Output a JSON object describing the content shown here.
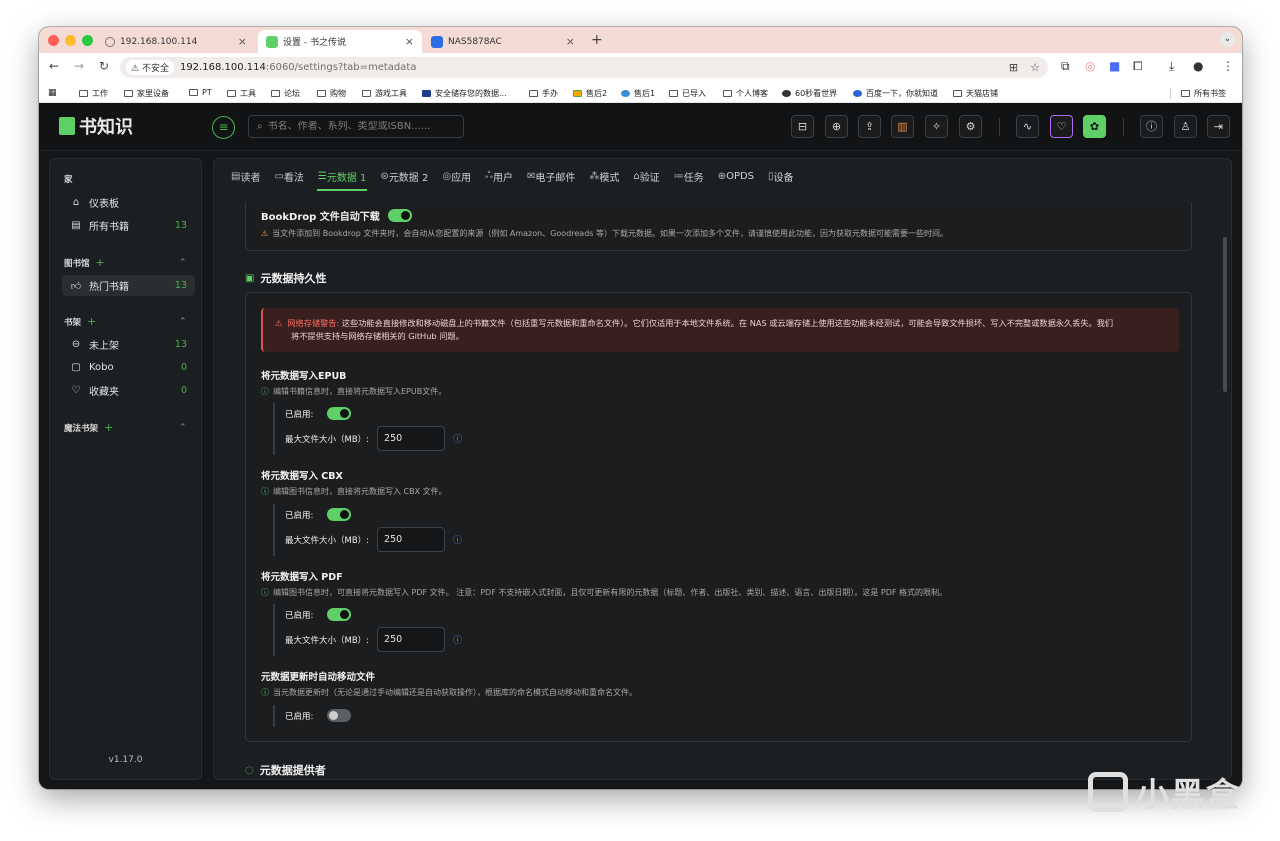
{
  "browser": {
    "tabs": [
      {
        "title": "192.168.100.114"
      },
      {
        "title": "设置 - 书之传说"
      },
      {
        "title": "NAS5878AC"
      }
    ],
    "security_label": "不安全",
    "url_host": "192.168.100.114",
    "url_path": ":6060/settings?tab=metadata",
    "bookmarks": [
      "工作",
      "家里设备",
      "PT",
      "工具",
      "论坛",
      "购物",
      "游戏工具",
      "安全储存您的数据...",
      "手办",
      "售后2",
      "售后1",
      "已导入",
      "个人博客",
      "60秒看世界",
      "百度一下，你就知道",
      "天猫店铺"
    ],
    "all_bookmarks": "所有书签"
  },
  "app": {
    "logo": "书知识",
    "search_placeholder": "书名、作者、系列、类型或ISBN......"
  },
  "sidebar": {
    "home_section": "家",
    "home_items": [
      {
        "label": "仪表板",
        "icon": "home-icon"
      },
      {
        "label": "所有书籍",
        "icon": "book-icon",
        "count": "13"
      }
    ],
    "library_section": "图书馆",
    "library_items": [
      {
        "label": "热门书籍",
        "icon": "thumbs-up-icon",
        "count": "13"
      }
    ],
    "shelves_section": "书架",
    "shelf_items": [
      {
        "label": "未上架",
        "icon": "inbox-icon",
        "count": "13"
      },
      {
        "label": "Kobo",
        "icon": "kobo-icon",
        "count": "0"
      },
      {
        "label": "收藏夹",
        "icon": "heart-icon",
        "count": "0"
      }
    ],
    "magic_section": "魔法书架",
    "version": "v1.17.0"
  },
  "settings_tabs": [
    {
      "label": "读者",
      "icon": "reader-icon"
    },
    {
      "label": "看法",
      "icon": "monitor-icon"
    },
    {
      "label": "元数据 1",
      "icon": "sliders-icon",
      "active": true
    },
    {
      "label": "元数据 2",
      "icon": "database-icon"
    },
    {
      "label": "应用",
      "icon": "app-icon"
    },
    {
      "label": "用户",
      "icon": "users-icon"
    },
    {
      "label": "电子邮件",
      "icon": "mail-icon"
    },
    {
      "label": "模式",
      "icon": "sitemap-icon"
    },
    {
      "label": "验证",
      "icon": "lock-icon"
    },
    {
      "label": "任务",
      "icon": "list-icon"
    },
    {
      "label": "OPDS",
      "icon": "globe-icon"
    },
    {
      "label": "设备",
      "icon": "device-icon"
    }
  ],
  "content": {
    "bookdrop": {
      "title": "BookDrop 文件自动下载",
      "enabled": true,
      "hint": "当文件添加到 Bookdrop 文件夹时，会自动从您配置的来源（例如 Amazon、Goodreads 等）下载元数据。如果一次添加多个文件，请谨慎使用此功能，因为获取元数据可能需要一些时间。"
    },
    "persistence_title": "元数据持久性",
    "warning_label": "网络存储警告:",
    "warning_text": "这些功能会直接修改和移动磁盘上的书籍文件（包括重写元数据和重命名文件）。它们仅适用于本地文件系统。在 NAS 或云端存储上使用这些功能未经测试，可能会导致文件损坏、写入不完整或数据永久丢失。我们",
    "warning_text2": "将不提供支持与网络存储相关的 GitHub 问题。",
    "epub": {
      "title": "将元数据写入EPUB",
      "hint": "编辑书籍信息时，直接将元数据写入EPUB文件。",
      "enabled_label": "已启用:",
      "size_label": "最大文件大小（MB）:",
      "size_value": "250"
    },
    "cbx": {
      "title": "将元数据写入 CBX",
      "hint": "编辑图书信息时，直接将元数据写入 CBX 文件。",
      "enabled_label": "已启用:",
      "size_label": "最大文件大小（MB）:",
      "size_value": "250"
    },
    "pdf": {
      "title": "将元数据写入 PDF",
      "hint": "编辑图书信息时，可直接将元数据写入 PDF 文件。   注意：PDF 不支持嵌入式封面，且仅可更新有限的元数据（标题、作者、出版社、类别、描述、语言、出版日期）。这是 PDF 格式的限制。",
      "enabled_label": "已启用:",
      "size_label": "最大文件大小（MB）:",
      "size_value": "250"
    },
    "automove": {
      "title": "元数据更新时自动移动文件",
      "hint": "当元数据更新时（无论是通过手动编辑还是自动获取操作），根据库的命名模式自动移动和重命名文件。",
      "enabled_label": "已启用:",
      "enabled": false
    },
    "providers_title": "元数据提供者"
  },
  "watermark": "小黑盒"
}
